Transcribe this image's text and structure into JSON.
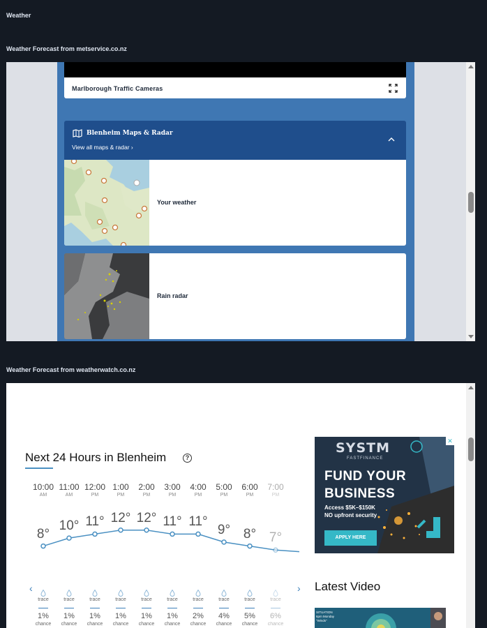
{
  "header": {
    "title": "Weather"
  },
  "sections": {
    "metservice_label": "Weather Forecast from metservice.co.nz",
    "weatherwatch_label": "Weather Forecast from weatherwatch.co.nz"
  },
  "metservice": {
    "traffic_cameras": "Marlborough Traffic Cameras",
    "maps_title": "Blenheim Maps & Radar",
    "maps_link": "View all maps & radar ›",
    "cards": [
      {
        "label": "Your weather"
      },
      {
        "label": "Rain radar"
      }
    ]
  },
  "weatherwatch": {
    "title": "Next 24 Hours in Blenheim",
    "help": "?",
    "hours": [
      {
        "time": "10:00",
        "ampm": "AM",
        "temp": "8°",
        "rain": "trace",
        "pct": "1%",
        "chance": "chance"
      },
      {
        "time": "11:00",
        "ampm": "AM",
        "temp": "10°",
        "rain": "trace",
        "pct": "1%",
        "chance": "chance"
      },
      {
        "time": "12:00",
        "ampm": "PM",
        "temp": "11°",
        "rain": "trace",
        "pct": "1%",
        "chance": "chance"
      },
      {
        "time": "1:00",
        "ampm": "PM",
        "temp": "12°",
        "rain": "trace",
        "pct": "1%",
        "chance": "chance"
      },
      {
        "time": "2:00",
        "ampm": "PM",
        "temp": "12°",
        "rain": "trace",
        "pct": "1%",
        "chance": "chance"
      },
      {
        "time": "3:00",
        "ampm": "PM",
        "temp": "11°",
        "rain": "trace",
        "pct": "1%",
        "chance": "chance"
      },
      {
        "time": "4:00",
        "ampm": "PM",
        "temp": "11°",
        "rain": "trace",
        "pct": "2%",
        "chance": "chance"
      },
      {
        "time": "5:00",
        "ampm": "PM",
        "temp": "9°",
        "rain": "trace",
        "pct": "4%",
        "chance": "chance"
      },
      {
        "time": "6:00",
        "ampm": "PM",
        "temp": "8°",
        "rain": "trace",
        "pct": "5%",
        "chance": "chance"
      },
      {
        "time": "7:00",
        "ampm": "PM",
        "temp": "7°",
        "rain": "trace",
        "pct": "6%",
        "chance": "chance"
      }
    ],
    "latest_video": "Latest Video",
    "video_text": [
      "SITUATION",
      "6pm Monday",
      "\"Winds\""
    ]
  },
  "ad": {
    "brand": "SYSTM",
    "brand_sub": "FASTFINANCE",
    "headline_1": "FUND YOUR",
    "headline_2": "BUSINESS",
    "line_1": "Access $5K–$150K",
    "line_2": "NO upfront security",
    "button": "APPLY HERE",
    "close": "✕"
  },
  "colors": {
    "page_bg": "#141a23",
    "metservice_blue": "#3f77b3",
    "metservice_dark_blue": "#1f4e8c",
    "chart_line": "#4a90c2",
    "ad_button": "#35b8c7"
  },
  "temperatures": [
    8,
    10,
    11,
    12,
    12,
    11,
    11,
    9,
    8,
    7
  ]
}
